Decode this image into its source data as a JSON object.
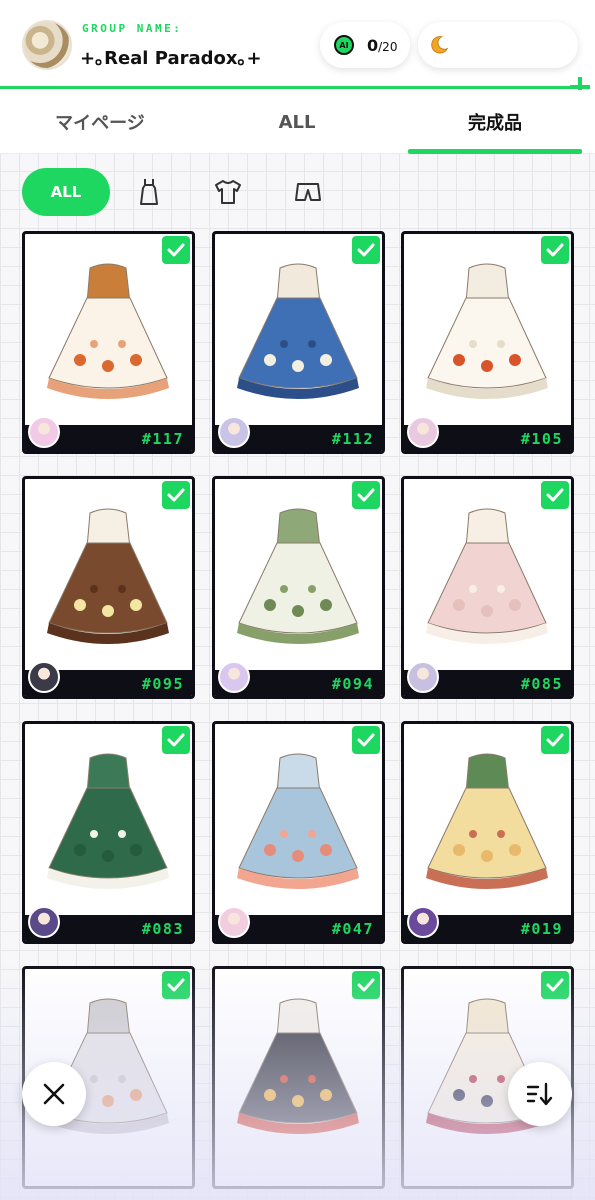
{
  "header": {
    "group_label": "GROUP NAME:",
    "group_name": "+｡Real Paradox｡+",
    "ai_credits": {
      "icon": "ai-coin-icon",
      "current": "0",
      "total": "/20"
    },
    "moon_currency": {
      "icon": "crescent-moon-icon"
    }
  },
  "tabs": [
    {
      "label": "マイページ",
      "active": false
    },
    {
      "label": "ALL",
      "active": false
    },
    {
      "label": "完成品",
      "active": true
    }
  ],
  "filters": [
    {
      "label": "ALL",
      "active": true
    },
    {
      "icon": "dress-icon"
    },
    {
      "icon": "shirt-icon"
    },
    {
      "icon": "shorts-icon"
    }
  ],
  "colors": {
    "accent": "#1ed760",
    "card_border": "#0e0e16"
  },
  "cards": [
    {
      "number": "#117",
      "checked": true,
      "outfit": "cream-dress-orange-flowers"
    },
    {
      "number": "#112",
      "checked": true,
      "outfit": "blue-denim-floral-dress"
    },
    {
      "number": "#105",
      "checked": true,
      "outfit": "white-dress-orange-flowers"
    },
    {
      "number": "#095",
      "checked": true,
      "outfit": "brown-vest-floral-dress"
    },
    {
      "number": "#094",
      "checked": true,
      "outfit": "green-white-lace-dress"
    },
    {
      "number": "#085",
      "checked": true,
      "outfit": "pink-lace-dress"
    },
    {
      "number": "#083",
      "checked": true,
      "outfit": "green-lace-dress"
    },
    {
      "number": "#047",
      "checked": true,
      "outfit": "light-blue-floral-dress"
    },
    {
      "number": "#019",
      "checked": true,
      "outfit": "harlequin-yellow-dress"
    },
    {
      "number": "",
      "checked": true,
      "outfit": "sheer-floral-skirt"
    },
    {
      "number": "",
      "checked": true,
      "outfit": "patchwork-dress"
    },
    {
      "number": "",
      "checked": true,
      "outfit": "cream-rose-skirt"
    }
  ],
  "close_button": {
    "icon": "close-icon"
  },
  "sort_button": {
    "icon": "sort-icon"
  }
}
